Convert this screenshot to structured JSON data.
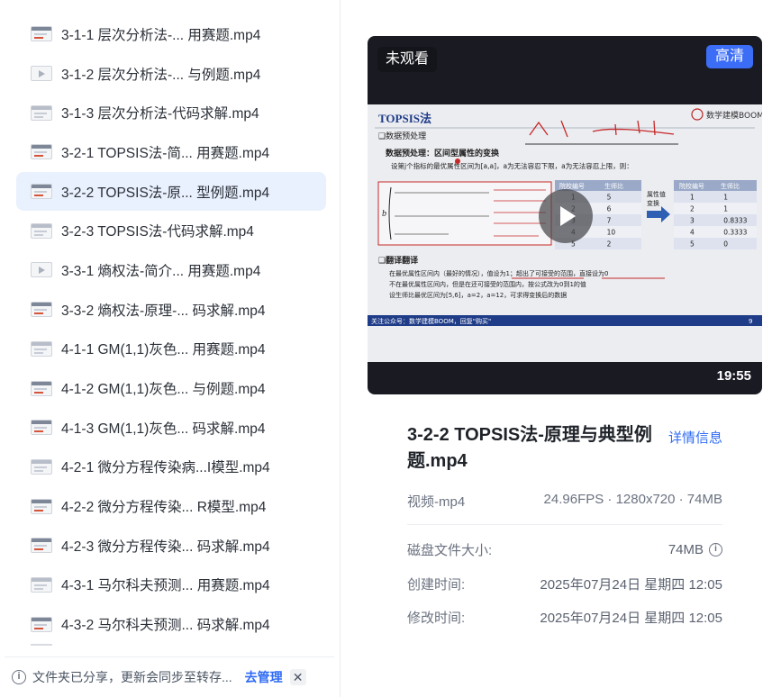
{
  "files": [
    {
      "name": "3-1-1 层次分析法-...   用赛题.mp4",
      "selected": false
    },
    {
      "name": "3-1-2 层次分析法-...   与例题.mp4",
      "selected": false
    },
    {
      "name": "3-1-3 层次分析法-代码求解.mp4",
      "selected": false
    },
    {
      "name": "3-2-1 TOPSIS法-简...   用赛题.mp4",
      "selected": false
    },
    {
      "name": "3-2-2 TOPSIS法-原...   型例题.mp4",
      "selected": true
    },
    {
      "name": "3-2-3 TOPSIS法-代码求解.mp4",
      "selected": false
    },
    {
      "name": "3-3-1 熵权法-简介...   用赛题.mp4",
      "selected": false
    },
    {
      "name": "3-3-2 熵权法-原理-...   码求解.mp4",
      "selected": false
    },
    {
      "name": "4-1-1 GM(1,1)灰色...   用赛题.mp4",
      "selected": false
    },
    {
      "name": "4-1-2 GM(1,1)灰色...   与例题.mp4",
      "selected": false
    },
    {
      "name": "4-1-3 GM(1,1)灰色...   码求解.mp4",
      "selected": false
    },
    {
      "name": "4-2-1 微分方程传染病...I模型.mp4",
      "selected": false
    },
    {
      "name": "4-2-2 微分方程传染...   R模型.mp4",
      "selected": false
    },
    {
      "name": "4-2-3 微分方程传染...   码求解.mp4",
      "selected": false
    },
    {
      "name": "4-3-1 马尔科夫预测...   用赛题.mp4",
      "selected": false
    },
    {
      "name": "4-3-2 马尔科夫预测...   码求解.mp4",
      "selected": false
    }
  ],
  "notice": {
    "text": "文件夹已分享，更新会同步至转存...",
    "action": "去管理"
  },
  "preview": {
    "badge_unwatched": "未观看",
    "badge_quality": "高清",
    "duration": "19:55",
    "slide": {
      "title": "TOPSIS法",
      "brand": "数学建模BOOM",
      "section1": "❑数据预处理",
      "bullet1": "数据预处理：区间型属性的变换",
      "desc1": "设第j个指标的最优属性区间为[a,a]，a为无法容忍下限，a为无法容忍上限，则：",
      "table1_headers": [
        "院校编号",
        "生师比"
      ],
      "table1_rows": [
        [
          "1",
          "5"
        ],
        [
          "2",
          "6"
        ],
        [
          "3",
          "7"
        ],
        [
          "4",
          "10"
        ],
        [
          "5",
          "2"
        ]
      ],
      "arrow_label": "属性值\n变换",
      "table2_headers": [
        "院校编号",
        "生师比"
      ],
      "table2_rows": [
        [
          "1",
          "1"
        ],
        [
          "2",
          "1"
        ],
        [
          "3",
          "0.8333"
        ],
        [
          "4",
          "0.3333"
        ],
        [
          "5",
          "0"
        ]
      ],
      "section2": "❑翻译翻译",
      "notes": [
        "在最优属性区间内（最好的情况），值设为1；超出了可接受的范围，直接设为0",
        "不在最优属性区间内，但是在还可接受的范围内，按公式改为0到1的值",
        "设生师比最优区间为[5,6]，a=2，a=12，可求得变换后的数据"
      ],
      "footer": "关注公众号：数学建模BOOM，回复\"购买\"",
      "page_no": "9"
    }
  },
  "details": {
    "title": "3-2-2 TOPSIS法-原理与典型例题.mp4",
    "detail_link": "详情信息",
    "type": "视频-mp4",
    "specs": "24.96FPS · 1280x720 · 74MB",
    "size_label": "磁盘文件大小:",
    "size_value": "74MB",
    "created_label": "创建时间:",
    "created_value": "2025年07月24日 星期四 12:05",
    "modified_label": "修改时间:",
    "modified_value": "2025年07月24日 星期四 12:05"
  }
}
